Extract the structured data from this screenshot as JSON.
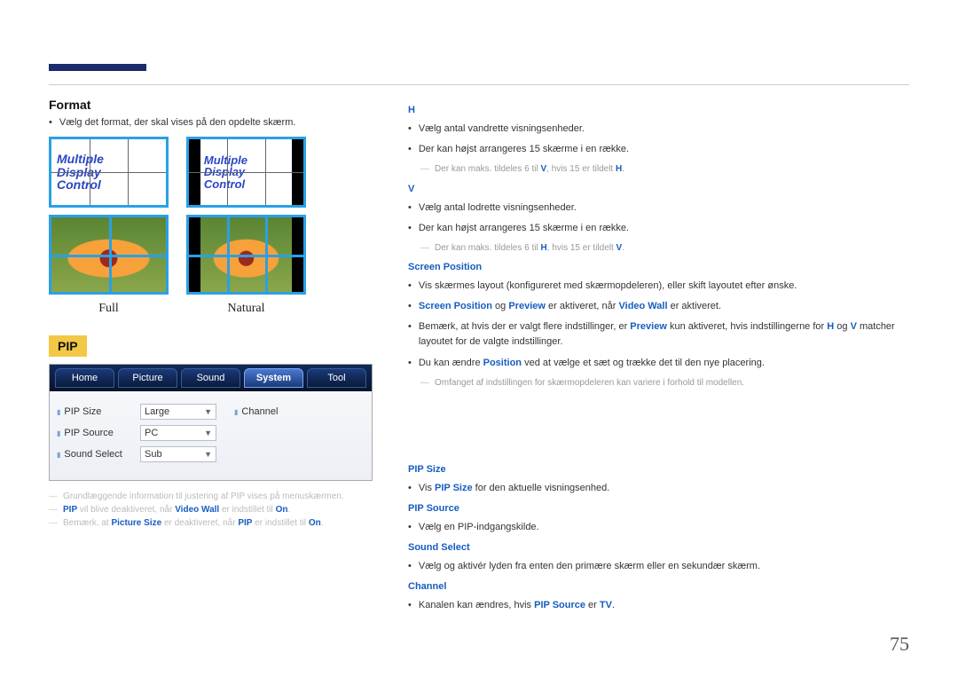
{
  "page_number": "75",
  "left": {
    "format": {
      "heading": "Format",
      "bullet": "Vælg det format, der skal vises på den opdelte skærm.",
      "mdc_lines": [
        "Multiple",
        "Display",
        "Control"
      ],
      "full_label": "Full",
      "natural_label": "Natural"
    },
    "pip": {
      "badge": "PIP",
      "tabs": [
        "Home",
        "Picture",
        "Sound",
        "System",
        "Tool"
      ],
      "active_tab_index": 3,
      "rows": [
        {
          "label": "PIP Size",
          "value": "Large",
          "dd": true
        },
        {
          "label": "PIP Source",
          "value": "PC",
          "dd": true
        },
        {
          "label": "Sound Select",
          "value": "Sub",
          "dd": true
        }
      ],
      "channel_label": "Channel",
      "notes": [
        {
          "pre": "Grundlæggende information til justering af  PIP vises på menuskærmen."
        },
        {
          "pre": "PIP",
          "mid": " vil blive deaktiveret, når ",
          "b1": "Video Wall",
          "mid2": " er indstillet til ",
          "b2": "On",
          "post": "."
        },
        {
          "pre": "Bemærk, at ",
          "b1": "Picture Size",
          "mid": " er deaktiveret, når ",
          "b2": "PIP",
          "mid2": " er indstillet til ",
          "b3": "On",
          "post": "."
        }
      ]
    }
  },
  "right": {
    "h": {
      "heading": "H",
      "b1": "Vælg antal vandrette visningsenheder.",
      "b2": "Der kan højst arrangeres 15 skærme i en række.",
      "sub_pre": "Der kan maks. tildeles 6 til ",
      "sub_bold1": "V",
      "sub_mid": ", hvis 15 er tildelt ",
      "sub_bold2": "H",
      "sub_post": "."
    },
    "v": {
      "heading": "V",
      "b1": "Vælg antal lodrette visningsenheder.",
      "b2": "Der kan højst arrangeres 15 skærme i en række.",
      "sub_pre": "Der kan maks. tildeles 6 til ",
      "sub_bold1": "H",
      "sub_mid": ", hvis 15 er tildelt ",
      "sub_bold2": "V",
      "sub_post": "."
    },
    "sp": {
      "heading": "Screen Position",
      "b1": "Vis skærmes layout (konfigureret med skærmopdeleren), eller skift layoutet efter ønske.",
      "b2_1": "Screen Position",
      "b2_mid1": " og ",
      "b2_2": "Preview",
      "b2_mid2": " er aktiveret, når ",
      "b2_3": "Video Wall",
      "b2_post": " er aktiveret.",
      "b3_pre": "Bemærk, at hvis der er valgt flere indstillinger, er ",
      "b3_1": "Preview",
      "b3_mid": " kun aktiveret, hvis indstillingerne for ",
      "b3_2": "H",
      "b3_mid2": " og ",
      "b3_3": "V",
      "b3_post": " matcher layoutet for de valgte indstillinger.",
      "b4_pre": "Du kan ændre ",
      "b4_1": "Position",
      "b4_post": " ved at vælge et sæt og trække det til den nye placering.",
      "sub": "Omfanget af indstillingen for skærmopdeleren kan variere i forhold til modellen."
    },
    "pip_size": {
      "heading": "PIP Size",
      "b_pre": "Vis ",
      "b_b": "PIP Size",
      "b_post": " for den aktuelle visningsenhed."
    },
    "pip_source": {
      "heading": "PIP Source",
      "b": "Vælg en PIP-indgangskilde."
    },
    "sound_select": {
      "heading": "Sound Select",
      "b": "Vælg og aktivér lyden fra enten den primære skærm eller en sekundær skærm."
    },
    "channel": {
      "heading": "Channel",
      "b_pre": "Kanalen kan ændres, hvis ",
      "b1": "PIP Source",
      "b_mid": " er ",
      "b2": "TV",
      "b_post": "."
    }
  }
}
